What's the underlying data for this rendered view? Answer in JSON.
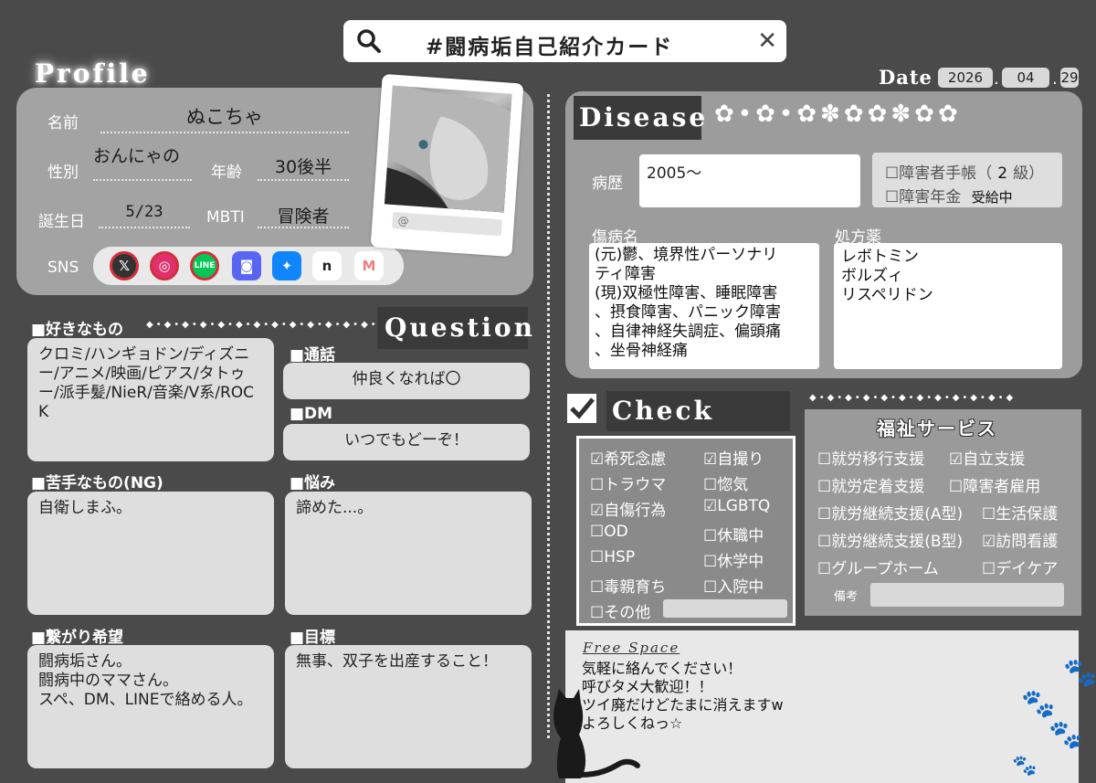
{
  "search": {
    "text": "#闘病垢自己紹介カード"
  },
  "header": {
    "profile_title": "Profile",
    "date_label": "Date",
    "year": "2026",
    "month": "04",
    "day": "29"
  },
  "profile": {
    "name_label": "名前",
    "name": "ぬこちゃ",
    "gender_label": "性別",
    "gender": "おんにゃの",
    "age_label": "年齢",
    "age": "30後半",
    "birthday_label": "誕生日",
    "birthday": "5/23",
    "mbti_label": "MBTI",
    "mbti": "冒険者",
    "sns_label": "SNS",
    "photo_handle": "@",
    "sns_icons": [
      {
        "name": "x-icon",
        "glyph": "𝕏",
        "color": "#222222"
      },
      {
        "name": "instagram-icon",
        "glyph": "◎",
        "color": "#e1306c"
      },
      {
        "name": "line-icon",
        "glyph": "LINE",
        "color": "#06c755"
      },
      {
        "name": "discord-icon",
        "glyph": "◙",
        "color": "#5865f2"
      },
      {
        "name": "bluesky-icon",
        "glyph": "🦋",
        "color": "#1185fe"
      },
      {
        "name": "note-icon",
        "glyph": "n",
        "color": "#222222"
      },
      {
        "name": "misskey-icon",
        "glyph": "M",
        "color": "#f08080"
      }
    ]
  },
  "sections": {
    "likes_title": "■好きなもの",
    "likes_text": "クロミ/ハンギョドン/ディズニー/アニメ/映画/ピアス/タトゥー/派手髪/NieR/音楽/V系/ROCK",
    "question_tag": "Question",
    "call_title": "■通話",
    "call_text": "仲良くなれば〇",
    "dm_title": "■DM",
    "dm_text": "いつでもどーぞ！",
    "ng_title": "■苦手なもの(NG)",
    "ng_text": "自衛しまふ。",
    "worry_title": "■悩み",
    "worry_text": "諦めた...。",
    "connect_title": "■繋がり希望",
    "connect_lines": [
      "闘病垢さん。",
      "闘病中のママさん。",
      "スペ、DM、LINEで絡める人。"
    ],
    "goal_title": "■目標",
    "goal_text": "無事、双子を出産すること！"
  },
  "disease": {
    "tag": "Disease",
    "history_label": "病歴",
    "history": "2005〜",
    "handbook_label": "☐障害者手帳（",
    "handbook_grade": "2",
    "handbook_unit": "級）",
    "pension_label": "☐障害年金",
    "pension_status": "受給中",
    "diagnosis_label": "傷病名",
    "diagnosis_lines": [
      "(元)鬱、境界性パーソナリ",
      "ティ障害",
      "(現)双極性障害、睡眠障害",
      "、摂食障害、パニック障害",
      "、自律神経失調症、偏頭痛",
      "、坐骨神経痛"
    ],
    "meds_label": "処方薬",
    "meds_lines": [
      "レボトミン",
      "ボルズィ",
      "リスペリドン"
    ]
  },
  "checklist": {
    "tag": "Check List",
    "items": [
      {
        "label": "☑希死念慮"
      },
      {
        "label": "☑自撮り"
      },
      {
        "label": "☐トラウマ"
      },
      {
        "label": "☐惚気"
      },
      {
        "label": "☑自傷行為"
      },
      {
        "label": "☑LGBTQ"
      },
      {
        "label": "☐OD"
      },
      {
        "label": "☐休職中"
      },
      {
        "label": "☐HSP"
      },
      {
        "label": "☐休学中"
      },
      {
        "label": "☐毒親育ち"
      },
      {
        "label": "☐入院中"
      },
      {
        "label": "☐その他"
      }
    ]
  },
  "welfare": {
    "title": "福祉サービス",
    "items": [
      {
        "label": "☐就労移行支援"
      },
      {
        "label": "☑自立支援"
      },
      {
        "label": "☐就労定着支援"
      },
      {
        "label": "☐障害者雇用"
      },
      {
        "label": "☐就労継続支援(A型)"
      },
      {
        "label": "☐生活保護"
      },
      {
        "label": "☐就労継続支援(B型)"
      },
      {
        "label": "☑訪問看護"
      },
      {
        "label": "☐グループホーム"
      },
      {
        "label": "☐デイケア"
      }
    ],
    "notes_label": "備考"
  },
  "free_space": {
    "title": "Free Space",
    "lines": [
      "気軽に絡んでください！",
      "呼びタメ大歓迎！！",
      "ツイ廃だけどたまに消えますw",
      "よろしくねっ☆"
    ]
  }
}
